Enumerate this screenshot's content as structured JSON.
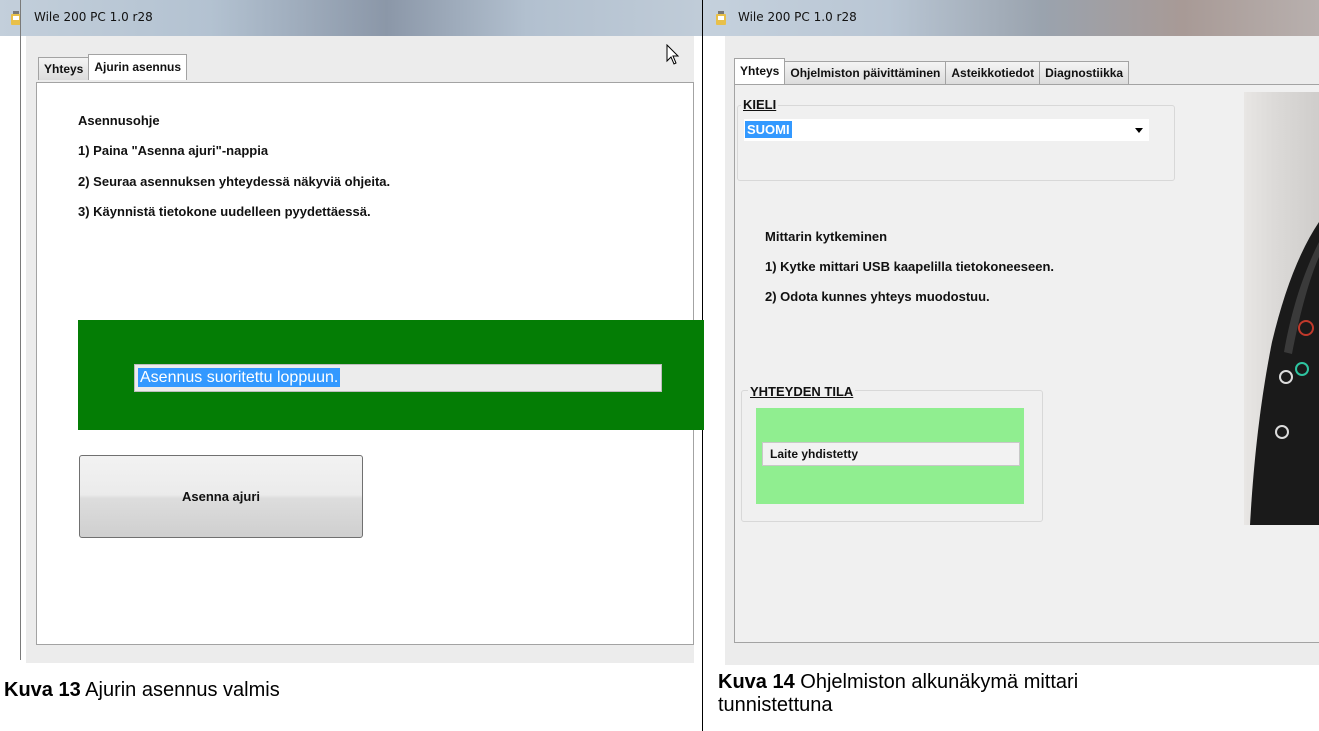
{
  "left": {
    "window_title": "Wile 200 PC 1.0 r28",
    "tabs": [
      "Yhteys",
      "Ajurin asennus"
    ],
    "instructions": {
      "heading": "Asennusohje",
      "steps": [
        "1) Paina \"Asenna ajuri\"-nappia",
        "2) Seuraa asennuksen yhteydessä näkyviä ohjeita.",
        "3) Käynnistä tietokone uudelleen pyydettäessä."
      ]
    },
    "status_text": "Asennus suoritettu loppuun.",
    "install_button": "Asenna ajuri",
    "caption": {
      "label": "Kuva 13",
      "text": " Ajurin asennus valmis"
    }
  },
  "right": {
    "window_title": "Wile 200 PC 1.0 r28",
    "tabs": [
      "Yhteys",
      "Ohjelmiston päivittäminen",
      "Asteikkotiedot",
      "Diagnostiikka"
    ],
    "language": {
      "label": "KIELI",
      "selected": "SUOMI"
    },
    "connect_instructions": {
      "heading": "Mittarin kytkeminen",
      "steps": [
        "1) Kytke mittari USB kaapelilla tietokoneeseen.",
        "2) Odota kunnes yhteys muodostuu."
      ]
    },
    "connection_state": {
      "label": "YHTEYDEN TILA",
      "value": "Laite yhdistetty"
    },
    "caption": {
      "label": "Kuva 14",
      "line1": " Ohjelmiston alkunäkymä mittari",
      "line2": "tunnistettuna"
    }
  },
  "colors": {
    "status_band": "#047d05",
    "selection": "#3399ff",
    "connected_panel": "#90ee90"
  },
  "icons": [
    "app-icon",
    "mouse-cursor-icon",
    "dropdown-arrow-icon"
  ]
}
